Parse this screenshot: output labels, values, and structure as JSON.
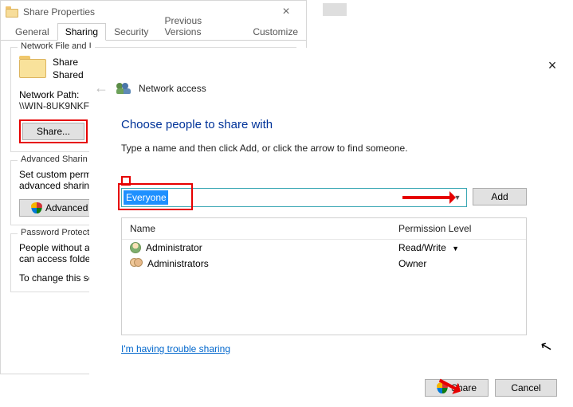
{
  "propDialog": {
    "title": "Share Properties",
    "tabs": [
      "General",
      "Sharing",
      "Security",
      "Previous Versions",
      "Customize"
    ],
    "activeTab": 1,
    "group1": {
      "legend": "Network File and I",
      "line1": "Share",
      "line2": "Shared",
      "pathLabel": "Network Path:",
      "pathValue": "\\\\WIN-8UK9NKF",
      "shareBtn": "Share..."
    },
    "group2": {
      "legend": "Advanced Sharin",
      "desc1": "Set custom permis",
      "desc2": "advanced sharing",
      "advBtn": "Advanced"
    },
    "group3": {
      "legend": "Password Protecti",
      "desc1": "People without a",
      "desc2": "can access folder",
      "desc3": "To change this se"
    }
  },
  "wizard": {
    "headTitle": "Network access",
    "h1": "Choose people to share with",
    "sub": "Type a name and then click Add, or click the arrow to find someone.",
    "comboValue": "Everyone",
    "addBtn": "Add",
    "colName": "Name",
    "colPerm": "Permission Level",
    "rows": [
      {
        "name": "Administrator",
        "perm": "Read/Write",
        "caret": true,
        "iconType": "user"
      },
      {
        "name": "Administrators",
        "perm": "Owner",
        "caret": false,
        "iconType": "users"
      }
    ],
    "trouble": "I'm having trouble sharing",
    "shareBtn": "Share",
    "cancelBtn": "Cancel"
  }
}
